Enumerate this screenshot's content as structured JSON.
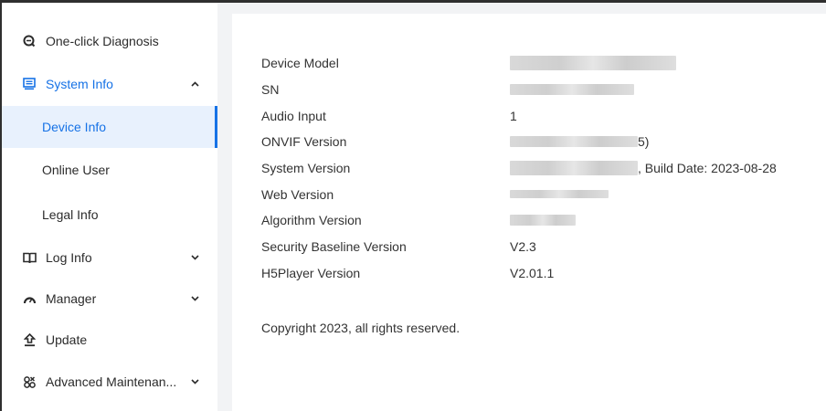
{
  "sidebar": {
    "items": [
      {
        "label": "One-click Diagnosis"
      },
      {
        "label": "System Info"
      },
      {
        "label": "Log Info"
      },
      {
        "label": "Manager"
      },
      {
        "label": "Update"
      },
      {
        "label": "Advanced Maintenan..."
      }
    ],
    "subitems": [
      {
        "label": "Device Info"
      },
      {
        "label": "Online User"
      },
      {
        "label": "Legal Info"
      }
    ]
  },
  "device_info": {
    "rows": [
      {
        "label": "Device Model",
        "value": ""
      },
      {
        "label": "SN",
        "value": ""
      },
      {
        "label": "Audio Input",
        "value": "1"
      },
      {
        "label": "ONVIF Version",
        "value": "5)"
      },
      {
        "label": "System Version",
        "value": ", Build Date: 2023-08-28"
      },
      {
        "label": "Web Version",
        "value": ""
      },
      {
        "label": "Algorithm Version",
        "value": ""
      },
      {
        "label": "Security Baseline Version",
        "value": "V2.3"
      },
      {
        "label": "H5Player Version",
        "value": "V2.01.1"
      }
    ],
    "copyright": "Copyright 2023, all rights reserved."
  },
  "colors": {
    "accent": "#1672e6",
    "content_bg": "#f2f3f5",
    "selected_bg": "#e8f1fd"
  }
}
